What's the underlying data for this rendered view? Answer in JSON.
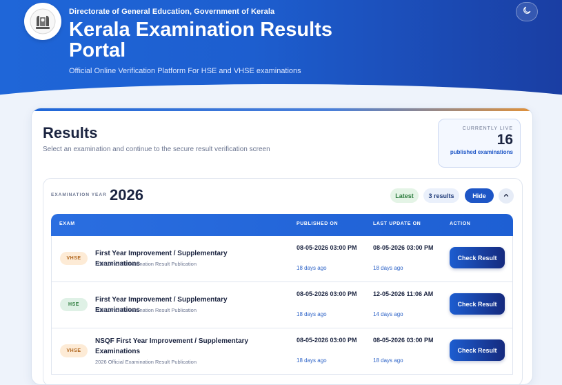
{
  "header": {
    "directorate": "Directorate of General Education, Government of Kerala",
    "title": "Kerala Examination Results Portal",
    "subtitle": "Official Online Verification Platform For HSE and VHSE examinations"
  },
  "results": {
    "title": "Results",
    "description": "Select an examination and continue to the secure result verification screen",
    "live": {
      "label": "CURRENTLY LIVE",
      "count": "16",
      "sub": "published examinations"
    }
  },
  "year_group": {
    "label": "EXAMINATION YEAR",
    "year": "2026",
    "latest": "Latest",
    "count": "3 results",
    "hide": "Hide"
  },
  "table": {
    "headers": [
      "EXAM",
      "PUBLISHED ON",
      "LAST UPDATE ON",
      "ACTION"
    ],
    "rows": [
      {
        "badge": "VHSE",
        "name": "First Year Improvement / Supplementary Examinations",
        "sub": "2026 Official Examination Result Publication",
        "published": "08-05-2026 03:00 PM",
        "published_ago": "18 days ago",
        "updated": "08-05-2026 03:00 PM",
        "updated_ago": "18 days ago",
        "action": "Check Result"
      },
      {
        "badge": "HSE",
        "name": "First Year Improvement / Supplementary Examinations",
        "sub": "2026 Official Examination Result Publication",
        "published": "08-05-2026 03:00 PM",
        "published_ago": "18 days ago",
        "updated": "12-05-2026 11:06 AM",
        "updated_ago": "14 days ago",
        "action": "Check Result"
      },
      {
        "badge": "VHSE",
        "name": "NSQF First Year Improvement / Supplementary Examinations",
        "sub": "2026 Official Examination Result Publication",
        "published": "08-05-2026 03:00 PM",
        "published_ago": "18 days ago",
        "updated": "08-05-2026 03:00 PM",
        "updated_ago": "18 days ago",
        "action": "Check Result"
      }
    ]
  },
  "icons": {
    "logo": "kerala-emblem-icon",
    "theme": "moon-icon",
    "collapse": "chevron-up-icon"
  },
  "colors": {
    "primary": "#1e56c6",
    "header_gradient_start": "#1f66d8",
    "header_gradient_end": "#1a3ea3",
    "accent_orange": "#e0913a"
  }
}
